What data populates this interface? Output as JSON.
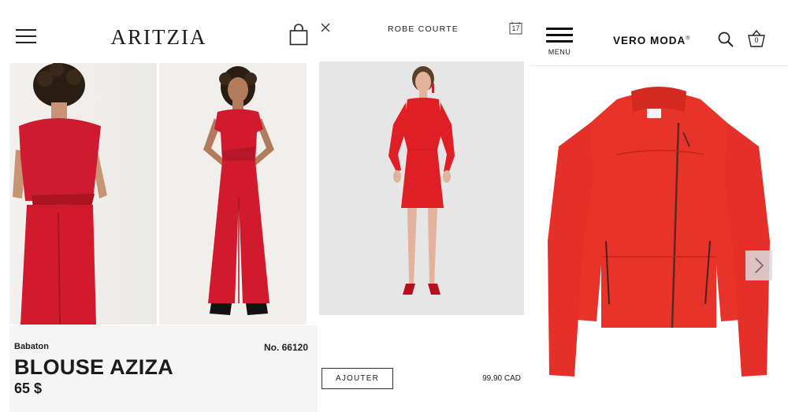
{
  "aritzia": {
    "brand": "ARITZIA",
    "vendor": "Babaton",
    "product_number": "No. 66120",
    "product_title": "BLOUSE AZIZA",
    "price": "65 $"
  },
  "zara": {
    "title": "ROBE COURTE",
    "calendar_day": "17",
    "add_button": "AJOUTER",
    "price": "99,90 CAD"
  },
  "veromoda": {
    "menu_label": "MENU",
    "brand": "VERO MODA",
    "brand_mark": "®",
    "basket_count": "0"
  },
  "colors": {
    "product_red": "#d21a2e",
    "dress_red": "#e01e26",
    "jacket_red": "#e8332a"
  },
  "icons": {
    "aritzia_menu": "hamburger-icon",
    "aritzia_bag": "shopping-bag-icon",
    "zara_close": "close-icon",
    "zara_calendar": "calendar-icon",
    "veromoda_menu": "hamburger-icon",
    "veromoda_search": "search-icon",
    "veromoda_basket": "basket-icon",
    "carousel_next": "chevron-right-icon"
  }
}
